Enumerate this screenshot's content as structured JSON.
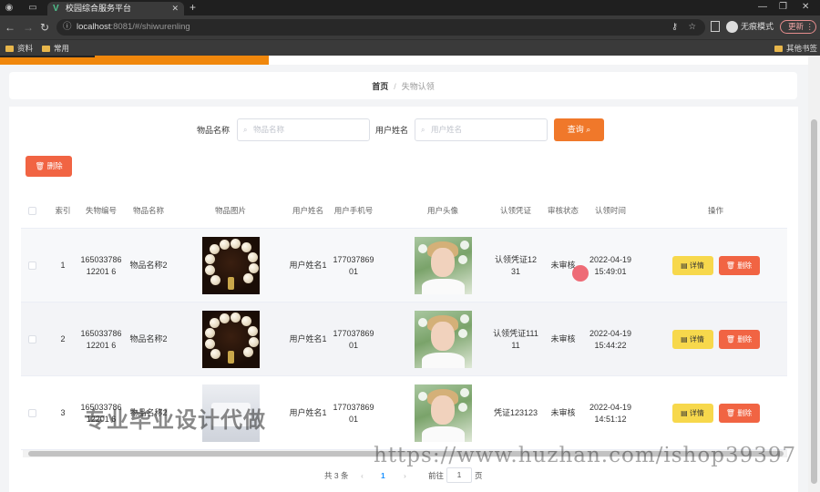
{
  "browser": {
    "tab_title": "校园综合服务平台",
    "url_host": "localhost",
    "url_path": ":8081/#/shiwurenling",
    "incognito_label": "无痕模式",
    "update_label": "更新",
    "bookmarks": [
      "资料",
      "常用"
    ],
    "other_bookmarks": "其他书签"
  },
  "breadcrumb": {
    "home": "首页",
    "separator": "/",
    "current": "失物认领"
  },
  "filters": {
    "item_name_label": "物品名称",
    "item_name_placeholder": "物品名称",
    "user_name_label": "用户姓名",
    "user_name_placeholder": "用户姓名",
    "query_label": "查询",
    "delete_label": "删除"
  },
  "table": {
    "headers": {
      "index": "索引",
      "lost_no": "失物编号",
      "item_name": "物品名称",
      "item_image": "物品图片",
      "user_name": "用户姓名",
      "user_phone": "用户手机号",
      "user_avatar": "用户头像",
      "claim_proof": "认领凭证",
      "review_status": "审核状态",
      "claim_time": "认领时间",
      "actions": "操作"
    },
    "rows": [
      {
        "index": "1",
        "lost_no": "16503378612201 6",
        "item_name": "物品名称2",
        "user_name": "用户姓名1",
        "user_phone": "17703786901",
        "claim_proof": "认领凭证1231",
        "review_status": "未审核",
        "claim_time": "2022-04-19 15:49:01"
      },
      {
        "index": "2",
        "lost_no": "16503378612201 6",
        "item_name": "物品名称2",
        "user_name": "用户姓名1",
        "user_phone": "17703786901",
        "claim_proof": "认领凭证11111",
        "review_status": "未审核",
        "claim_time": "2022-04-19 15:44:22"
      },
      {
        "index": "3",
        "lost_no": "16503378612201 6",
        "item_name": "物品名称2",
        "user_name": "用户姓名1",
        "user_phone": "17703786901",
        "claim_proof": "凭证123123",
        "review_status": "未审核",
        "claim_time": "2022-04-19 14:51:12"
      }
    ],
    "detail_label": "详情",
    "delete_label": "删除"
  },
  "pagination": {
    "total_text": "共 3 条",
    "current_page": "1",
    "goto_label": "前往",
    "goto_value": "1",
    "page_unit": "页"
  },
  "watermarks": {
    "left": "专业毕业设计代做",
    "right": "https://www.huzhan.com/ishop39397"
  }
}
